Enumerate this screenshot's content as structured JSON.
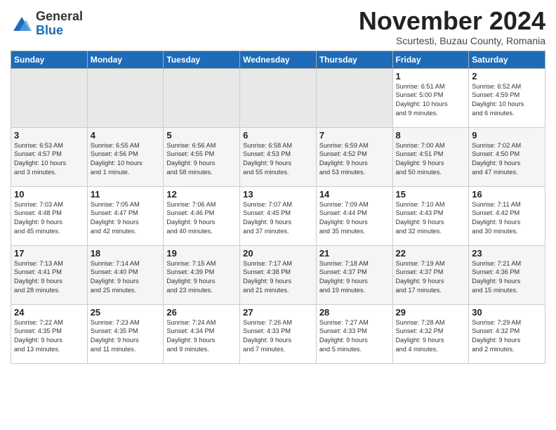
{
  "logo": {
    "line1": "General",
    "line2": "Blue"
  },
  "title": "November 2024",
  "subtitle": "Scurtesti, Buzau County, Romania",
  "weekdays": [
    "Sunday",
    "Monday",
    "Tuesday",
    "Wednesday",
    "Thursday",
    "Friday",
    "Saturday"
  ],
  "weeks": [
    [
      {
        "day": "",
        "detail": ""
      },
      {
        "day": "",
        "detail": ""
      },
      {
        "day": "",
        "detail": ""
      },
      {
        "day": "",
        "detail": ""
      },
      {
        "day": "",
        "detail": ""
      },
      {
        "day": "1",
        "detail": "Sunrise: 6:51 AM\nSunset: 5:00 PM\nDaylight: 10 hours\nand 9 minutes."
      },
      {
        "day": "2",
        "detail": "Sunrise: 6:52 AM\nSunset: 4:59 PM\nDaylight: 10 hours\nand 6 minutes."
      }
    ],
    [
      {
        "day": "3",
        "detail": "Sunrise: 6:53 AM\nSunset: 4:57 PM\nDaylight: 10 hours\nand 3 minutes."
      },
      {
        "day": "4",
        "detail": "Sunrise: 6:55 AM\nSunset: 4:56 PM\nDaylight: 10 hours\nand 1 minute."
      },
      {
        "day": "5",
        "detail": "Sunrise: 6:56 AM\nSunset: 4:55 PM\nDaylight: 9 hours\nand 58 minutes."
      },
      {
        "day": "6",
        "detail": "Sunrise: 6:58 AM\nSunset: 4:53 PM\nDaylight: 9 hours\nand 55 minutes."
      },
      {
        "day": "7",
        "detail": "Sunrise: 6:59 AM\nSunset: 4:52 PM\nDaylight: 9 hours\nand 53 minutes."
      },
      {
        "day": "8",
        "detail": "Sunrise: 7:00 AM\nSunset: 4:51 PM\nDaylight: 9 hours\nand 50 minutes."
      },
      {
        "day": "9",
        "detail": "Sunrise: 7:02 AM\nSunset: 4:50 PM\nDaylight: 9 hours\nand 47 minutes."
      }
    ],
    [
      {
        "day": "10",
        "detail": "Sunrise: 7:03 AM\nSunset: 4:48 PM\nDaylight: 9 hours\nand 45 minutes."
      },
      {
        "day": "11",
        "detail": "Sunrise: 7:05 AM\nSunset: 4:47 PM\nDaylight: 9 hours\nand 42 minutes."
      },
      {
        "day": "12",
        "detail": "Sunrise: 7:06 AM\nSunset: 4:46 PM\nDaylight: 9 hours\nand 40 minutes."
      },
      {
        "day": "13",
        "detail": "Sunrise: 7:07 AM\nSunset: 4:45 PM\nDaylight: 9 hours\nand 37 minutes."
      },
      {
        "day": "14",
        "detail": "Sunrise: 7:09 AM\nSunset: 4:44 PM\nDaylight: 9 hours\nand 35 minutes."
      },
      {
        "day": "15",
        "detail": "Sunrise: 7:10 AM\nSunset: 4:43 PM\nDaylight: 9 hours\nand 32 minutes."
      },
      {
        "day": "16",
        "detail": "Sunrise: 7:11 AM\nSunset: 4:42 PM\nDaylight: 9 hours\nand 30 minutes."
      }
    ],
    [
      {
        "day": "17",
        "detail": "Sunrise: 7:13 AM\nSunset: 4:41 PM\nDaylight: 9 hours\nand 28 minutes."
      },
      {
        "day": "18",
        "detail": "Sunrise: 7:14 AM\nSunset: 4:40 PM\nDaylight: 9 hours\nand 25 minutes."
      },
      {
        "day": "19",
        "detail": "Sunrise: 7:15 AM\nSunset: 4:39 PM\nDaylight: 9 hours\nand 23 minutes."
      },
      {
        "day": "20",
        "detail": "Sunrise: 7:17 AM\nSunset: 4:38 PM\nDaylight: 9 hours\nand 21 minutes."
      },
      {
        "day": "21",
        "detail": "Sunrise: 7:18 AM\nSunset: 4:37 PM\nDaylight: 9 hours\nand 19 minutes."
      },
      {
        "day": "22",
        "detail": "Sunrise: 7:19 AM\nSunset: 4:37 PM\nDaylight: 9 hours\nand 17 minutes."
      },
      {
        "day": "23",
        "detail": "Sunrise: 7:21 AM\nSunset: 4:36 PM\nDaylight: 9 hours\nand 15 minutes."
      }
    ],
    [
      {
        "day": "24",
        "detail": "Sunrise: 7:22 AM\nSunset: 4:35 PM\nDaylight: 9 hours\nand 13 minutes."
      },
      {
        "day": "25",
        "detail": "Sunrise: 7:23 AM\nSunset: 4:35 PM\nDaylight: 9 hours\nand 11 minutes."
      },
      {
        "day": "26",
        "detail": "Sunrise: 7:24 AM\nSunset: 4:34 PM\nDaylight: 9 hours\nand 9 minutes."
      },
      {
        "day": "27",
        "detail": "Sunrise: 7:26 AM\nSunset: 4:33 PM\nDaylight: 9 hours\nand 7 minutes."
      },
      {
        "day": "28",
        "detail": "Sunrise: 7:27 AM\nSunset: 4:33 PM\nDaylight: 9 hours\nand 5 minutes."
      },
      {
        "day": "29",
        "detail": "Sunrise: 7:28 AM\nSunset: 4:32 PM\nDaylight: 9 hours\nand 4 minutes."
      },
      {
        "day": "30",
        "detail": "Sunrise: 7:29 AM\nSunset: 4:32 PM\nDaylight: 9 hours\nand 2 minutes."
      }
    ]
  ]
}
